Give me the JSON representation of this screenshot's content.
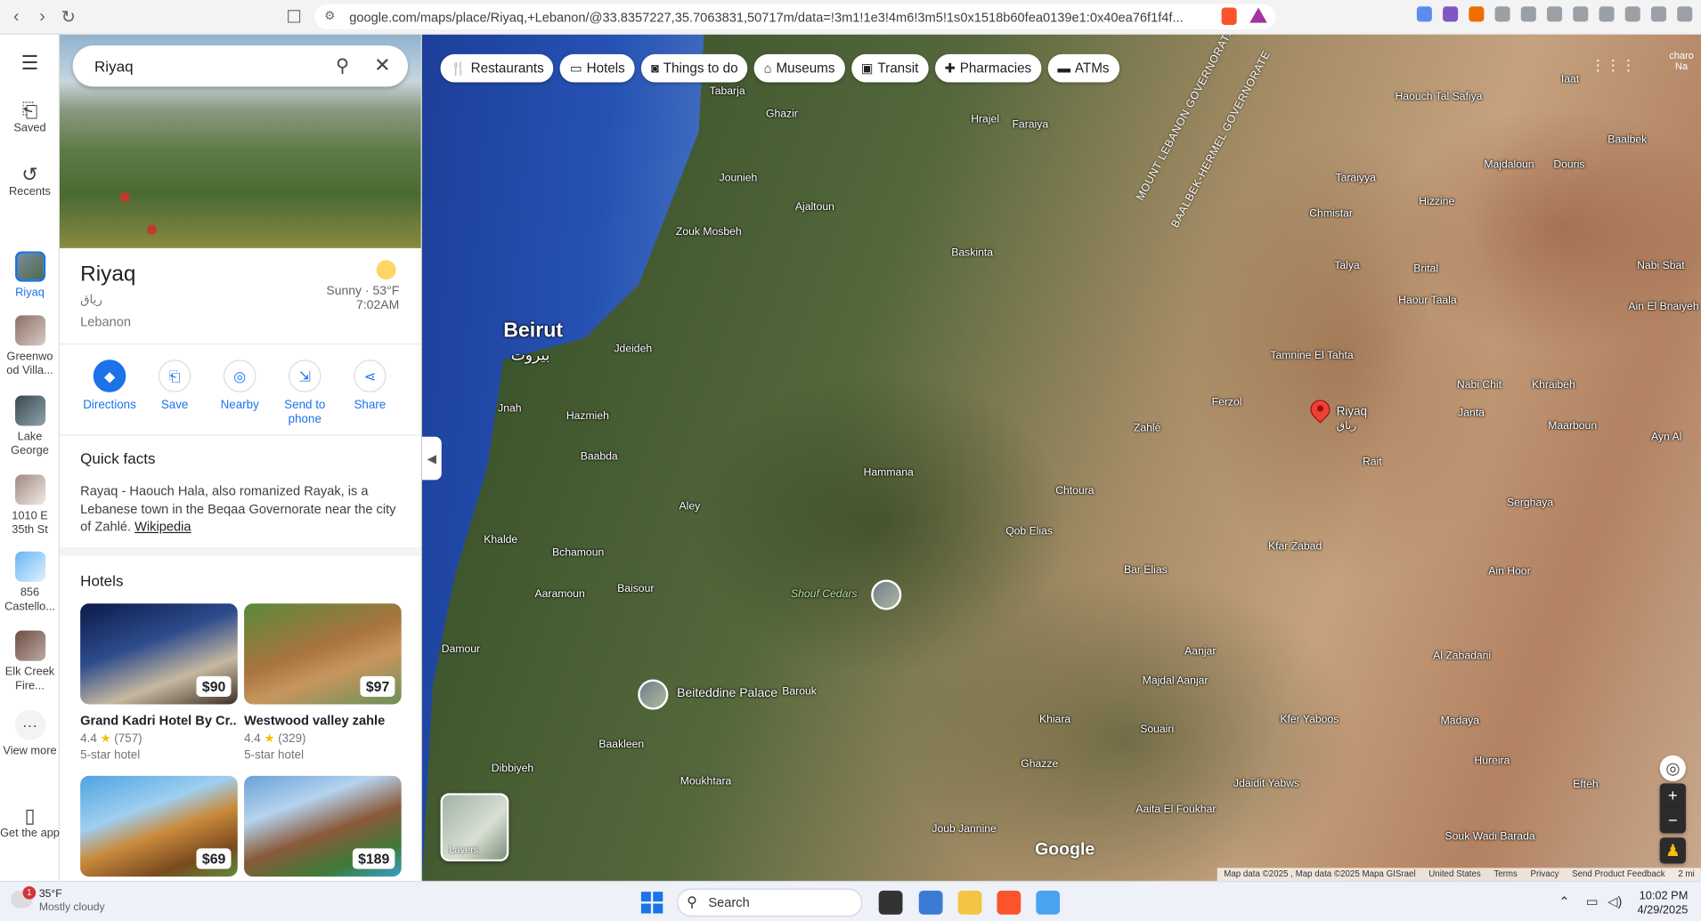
{
  "browser": {
    "url": "google.com/maps/place/Riyaq,+Lebanon/@33.8357227,35.7063831,50717m/data=!3m1!1e3!4m6!3m5!1s0x1518b60fea0139e1:0x40ea76f1f4f..."
  },
  "rail": {
    "saved": "Saved",
    "recents": "Recents",
    "riyaq": "Riyaq",
    "greenwood": "Greenwo od Villa...",
    "lake_george": "Lake George",
    "street1010": "1010 E 35th St",
    "castello": "856 Castello...",
    "elk_creek": "Elk Creek Fire...",
    "view_more": "View more",
    "get_app": "Get the app"
  },
  "panel": {
    "search_value": "Riyaq",
    "title": "Riyaq",
    "arabic_name": "رياق",
    "country": "Lebanon",
    "weather_cond": "Sunny · 53°F",
    "weather_time": "7:02AM",
    "actions": {
      "directions": "Directions",
      "save": "Save",
      "nearby": "Nearby",
      "send": "Send to phone",
      "share": "Share"
    },
    "quick_facts_title": "Quick facts",
    "quick_facts_text": "Rayaq - Haouch Hala, also romanized Rayak, is a Lebanese town in the Beqaa Governorate near the city of Zahlé.",
    "wiki_link": "Wikipedia",
    "hotels_title": "Hotels",
    "hotels": [
      {
        "price": "$90",
        "name": "Grand Kadri Hotel By Cr...",
        "rating": "4.4",
        "reviews": "(757)",
        "class": "5-star hotel"
      },
      {
        "price": "$97",
        "name": "Westwood valley zahle",
        "rating": "4.4",
        "reviews": "(329)",
        "class": "5-star hotel"
      },
      {
        "price": "$69"
      },
      {
        "price": "$189"
      }
    ]
  },
  "map": {
    "chips": [
      "Restaurants",
      "Hotels",
      "Things to do",
      "Museums",
      "Transit",
      "Pharmacies",
      "ATMs"
    ],
    "labels": {
      "beirut": "Beirut",
      "beirut_ar": "بيروت",
      "riyaq": "Riyaq",
      "riyaq_ar": "رياق",
      "zahle": "Zahlé",
      "chtoura": "Chtoura",
      "baalbek": "Baalbek",
      "beiteddine": "Beiteddine Palace",
      "shouf": "Shouf Cedars",
      "aley": "Aley",
      "baabda": "Baabda",
      "hammana": "Hammana",
      "jounieh": "Jounieh",
      "zouk": "Zouk Mosbeh",
      "ajaltoun": "Ajaltoun",
      "baskinta": "Baskinta",
      "damour": "Damour",
      "baakleen": "Baakleen",
      "barouk": "Barouk",
      "khiara": "Khiara",
      "ghazze": "Ghazze",
      "aanjar": "Aanjar",
      "serghaya": "Serghaya",
      "zabadani": "Al Zabadani",
      "madaya": "Madaya",
      "rayak_rait": "Rait",
      "tamnine": "Tamnine El Tahta",
      "ferzol": "Ferzol",
      "chmistar": "Chmistar",
      "qob_elias": "Qob Elias",
      "bar_elias": "Bar Elias",
      "kfar_zabad": "Kfar Zabad",
      "ain_hoor": "Ain Hoor",
      "majdal_aanjar": "Majdal Aanjar",
      "joub_jannine": "Joub Jannine",
      "dibbiyeh": "Dibbiyeh",
      "moukhtara": "Moukhtara",
      "aaramoun": "Aaramoun",
      "baisour": "Baisour",
      "bchamoun": "Bchamoun",
      "khalde": "Khalde",
      "jdeideh": "Jdeideh",
      "hazmieh": "Hazmieh",
      "tabarja": "Tabarja",
      "ghazir": "Ghazir",
      "hrajel": "Hrajel",
      "faraiya": "Faraiya",
      "hizzine": "Hizzine",
      "taiybe": "Taraiyya",
      "talya": "Talya",
      "brital": "Brital",
      "haour_taala": "Haour Taala",
      "nabi_chit": "Nabi Chit",
      "khraibeh": "Khraibeh",
      "janta": "Janta",
      "maarboun": "Maarboun",
      "majdaloun": "Majdaloun",
      "douris": "Douris",
      "iaat": "Iaat",
      "haouch_tal": "Haouch Tal Safiya",
      "nabi_sbat": "Nabi Sbat",
      "ain_el": "Ain El Bnaiyeh",
      "kfer_yaboos": "Kfer Yaboos",
      "jdaidit": "Jdaidit Yabws",
      "souairi": "Souairi",
      "aaita": "Aaita El Foukhar",
      "hureira": "Hureira",
      "efteh": "Efteh",
      "souk_wadi": "Souk Wadi Barada",
      "jnah": "Jnah",
      "ayn_al": "Ayn Al",
      "mount_lebanon": "MOUNT LEBANON GOVERNORATE",
      "baalbek_hermel": "BAALBEK-HERMEL GOVERNORATE"
    },
    "layers_label": "Layers",
    "google": "Google",
    "attribution": [
      "Map data ©2025 , Map data ©2025 Mapa GISrael",
      "United States",
      "Terms",
      "Privacy",
      "Send Product Feedback",
      "2 mi"
    ],
    "account": "charo Na"
  },
  "taskbar": {
    "temp": "35°F",
    "cond": "Mostly cloudy",
    "badge": "1",
    "search": "Search",
    "time": "10:02 PM",
    "date": "4/29/2025"
  }
}
